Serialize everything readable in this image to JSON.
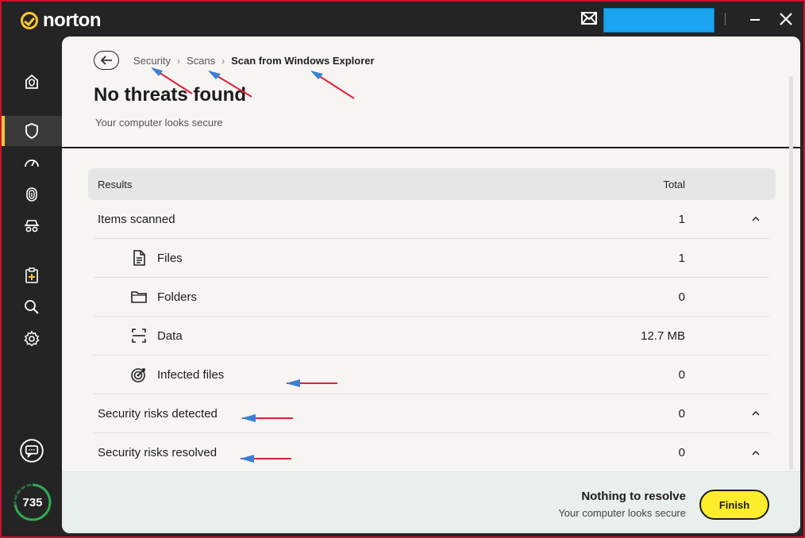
{
  "app": {
    "brand": "norton",
    "accent_color": "#ffc72c",
    "score": "735"
  },
  "titlebar": {
    "icons": [
      "mail-icon",
      "minimize-icon",
      "close-icon"
    ]
  },
  "sidebar": {
    "items": [
      {
        "name": "home-icon",
        "active": false
      },
      {
        "name": "shield-icon",
        "active": true
      },
      {
        "name": "speedometer-icon",
        "active": false
      },
      {
        "name": "fingerprint-icon",
        "active": false
      },
      {
        "name": "incognito-icon",
        "active": false
      },
      {
        "name": "clipboard-plus-icon",
        "active": false
      },
      {
        "name": "search-icon",
        "active": false
      },
      {
        "name": "gear-icon",
        "active": false
      }
    ]
  },
  "breadcrumb": {
    "items": [
      "Security",
      "Scans"
    ],
    "current": "Scan from Windows Explorer"
  },
  "page": {
    "title": "No threats found",
    "subtitle": "Your computer looks secure"
  },
  "results": {
    "header_label": "Results",
    "header_total": "Total",
    "rows": [
      {
        "label": "Items scanned",
        "value": "1",
        "level": "top"
      },
      {
        "label": "Files",
        "value": "1",
        "level": "sub",
        "icon": "file-icon"
      },
      {
        "label": "Folders",
        "value": "0",
        "level": "sub",
        "icon": "folder-icon"
      },
      {
        "label": "Data",
        "value": "12.7 MB",
        "level": "sub",
        "icon": "data-icon"
      },
      {
        "label": "Infected files",
        "value": "0",
        "level": "sub",
        "icon": "target-icon"
      },
      {
        "label": "Security risks detected",
        "value": "0",
        "level": "top"
      },
      {
        "label": "Security risks resolved",
        "value": "0",
        "level": "top"
      }
    ]
  },
  "footer": {
    "title": "Nothing to resolve",
    "subtitle": "Your computer looks secure",
    "finish_label": "Finish"
  }
}
